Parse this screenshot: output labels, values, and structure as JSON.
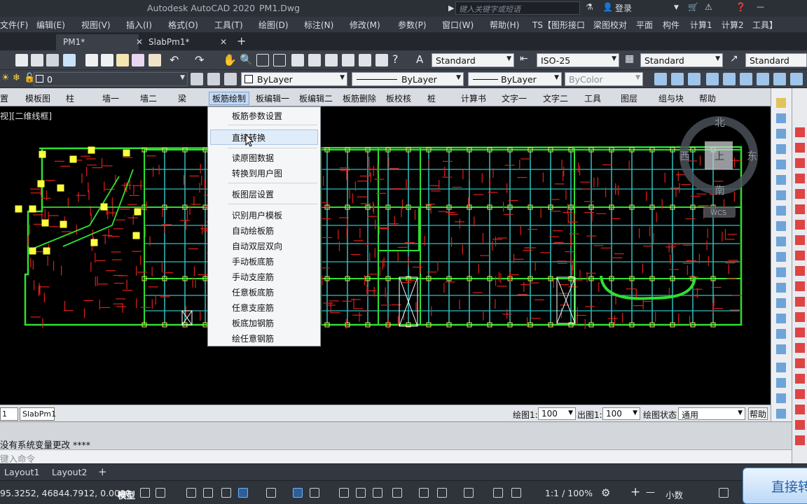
{
  "title": {
    "app": "Autodesk AutoCAD 2020",
    "file": "PM1.Dwg",
    "search_placeholder": "键入关键字或短语",
    "login": "登录"
  },
  "menubar": [
    "文件(F)",
    "编辑(E)",
    "视图(V)",
    "插入(I)",
    "格式(O)",
    "工具(T)",
    "绘图(D)",
    "标注(N)",
    "修改(M)",
    "参数(P)",
    "窗口(W)",
    "帮助(H)",
    "TS【图形接口",
    "梁图校对",
    "平面",
    "构件",
    "计算1",
    "计算2",
    "工具】"
  ],
  "file_tabs": [
    {
      "label": "PM1*"
    },
    {
      "label": "SlabPm1*"
    }
  ],
  "toolbar": {
    "text_style": "Standard",
    "dim_style": "ISO-25",
    "table_style": "Standard",
    "mleader_style": "Standard"
  },
  "properties": {
    "layer": "0",
    "color": "ByLayer",
    "linetype": "ByLayer",
    "lineweight": "ByLayer",
    "plotstyle": "ByColor"
  },
  "ribbon": [
    "置",
    "模板图",
    "柱",
    "墙一",
    "墙二",
    "梁",
    "板筋绘制",
    "板编辑一",
    "板编辑二",
    "板筋删除",
    "板校核",
    "桩",
    "计算书",
    "文字一",
    "文字二",
    "工具",
    "图层",
    "组与块",
    "帮助"
  ],
  "ribbon_selected": "板筋绘制",
  "viewport_label": "视][二维线框]",
  "viewcube": {
    "north": "北",
    "south": "南",
    "east": "东",
    "west": "西",
    "top": "上",
    "wcs": "WCS"
  },
  "dropdown_menu": {
    "items": [
      "板筋参数设置",
      "直接转换",
      "读原图数据",
      "转换到用户图",
      "板图层设置",
      "识别用户模板",
      "自动绘板筋",
      "自动双层双向",
      "手动板底筋",
      "手动支座筋",
      "任意板底筋",
      "任意支座筋",
      "板底加钢筋",
      "绘任意钢筋"
    ],
    "highlighted": "直接转换"
  },
  "drawing_status": {
    "sheets": [
      "1",
      "SlabPm1"
    ],
    "draw_scale_label": "绘图1:",
    "draw_scale": "100",
    "out_scale_label": "出图1:",
    "out_scale": "100",
    "state_label": "绘图状态",
    "state": "通用",
    "help": "帮助"
  },
  "command": {
    "history": "没有系统变量更改 ****",
    "placeholder": "键入命令"
  },
  "layout_tabs": [
    "Layout1",
    "Layout2",
    "+"
  ],
  "statusbar": {
    "coords": "95.3252, 46844.7912, 0.0000",
    "model": "模型",
    "scale": "1:1 / 100%",
    "units": "小数"
  },
  "tooltip": {
    "text": "直接转"
  },
  "colors": {
    "canvas": "#000000",
    "beam_green": "#2fe02f",
    "rebar_red": "#e0201a",
    "column_yellow": "#e8e85a",
    "axis_cyan": "#30c0c0"
  }
}
